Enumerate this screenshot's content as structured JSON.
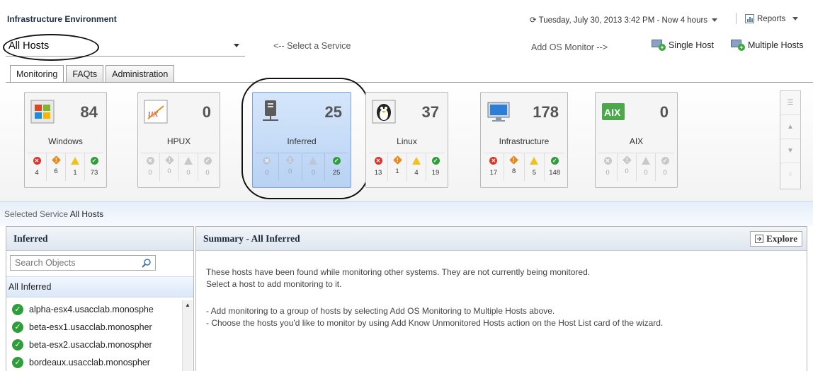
{
  "header": {
    "title": "Infrastructure Environment",
    "time_range": "⟳ Tuesday, July 30, 2013 3:42 PM - Now 4 hours",
    "reports_label": "Reports"
  },
  "service_select": {
    "value": "All Hosts",
    "hint": "<-- Select a Service"
  },
  "add_monitor": {
    "label": "Add OS Monitor -->",
    "single_host": "Single Host",
    "multiple_hosts": "Multiple Hosts"
  },
  "tabs": [
    "Monitoring",
    "FAQts",
    "Administration"
  ],
  "tiles": [
    {
      "name": "Windows",
      "count": "84",
      "stats": [
        "4",
        "6",
        "1",
        "73"
      ]
    },
    {
      "name": "HPUX",
      "count": "0",
      "stats": [
        "0",
        "0",
        "0",
        "0"
      ]
    },
    {
      "name": "Inferred",
      "count": "25",
      "stats": [
        "0",
        "0",
        "0",
        "25"
      ]
    },
    {
      "name": "Linux",
      "count": "37",
      "stats": [
        "13",
        "1",
        "4",
        "19"
      ]
    },
    {
      "name": "Infrastructure",
      "count": "178",
      "stats": [
        "17",
        "8",
        "5",
        "148"
      ]
    },
    {
      "name": "AIX",
      "count": "0",
      "stats": [
        "0",
        "0",
        "0",
        "0"
      ]
    }
  ],
  "selected_service": {
    "label": "Selected Service",
    "value": "All Hosts"
  },
  "left_panel": {
    "title": "Inferred",
    "search_placeholder": "Search Objects",
    "all_label": "All Inferred",
    "hosts": [
      "alpha-esx4.usacclab.monosphe",
      "beta-esx1.usacclab.monospher",
      "beta-esx2.usacclab.monospher",
      "bordeaux.usacclab.monospher"
    ]
  },
  "summary": {
    "title": "Summary - All Inferred",
    "explore_label": "Explore",
    "lines": [
      "These hosts have been found while monitoring other systems. They are not currently being monitored.",
      "Select a host to add monitoring to it.",
      "- Add monitoring to a group of hosts by selecting Add OS Monitoring to Multiple Hosts above.",
      "- Choose the hosts you'd like to monitor by using Add Know Unmonitored Hosts action on the Host List card of the wizard."
    ]
  },
  "colors": {
    "critical": "#d9332b",
    "major": "#e98a1e",
    "warning": "#f0c31b",
    "ok": "#2f9e3a",
    "selected_tile": "#c4dbf7"
  }
}
